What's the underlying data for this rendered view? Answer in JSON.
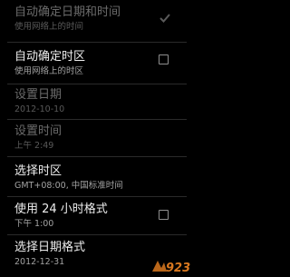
{
  "settings": [
    {
      "title": "自动确定日期和时间",
      "subtitle": "使用网络上的时间",
      "enabled": false,
      "control": "checkbox",
      "checked": true
    },
    {
      "title": "自动确定时区",
      "subtitle": "使用网络上的时区",
      "enabled": true,
      "control": "checkbox",
      "checked": false
    },
    {
      "title": "设置日期",
      "subtitle": "2012-10-10",
      "enabled": false,
      "control": "none"
    },
    {
      "title": "设置时间",
      "subtitle": "上午 2:49",
      "enabled": false,
      "control": "none"
    },
    {
      "title": "选择时区",
      "subtitle": "GMT+08:00, 中国标准时间",
      "enabled": true,
      "control": "none"
    },
    {
      "title": "使用 24 小时格式",
      "subtitle": "下午 1:00",
      "enabled": true,
      "control": "checkbox",
      "checked": false
    },
    {
      "title": "选择日期格式",
      "subtitle": "2012-12-31",
      "enabled": true,
      "control": "none"
    }
  ],
  "watermark": {
    "text": "923",
    "color": "#d9781f"
  }
}
